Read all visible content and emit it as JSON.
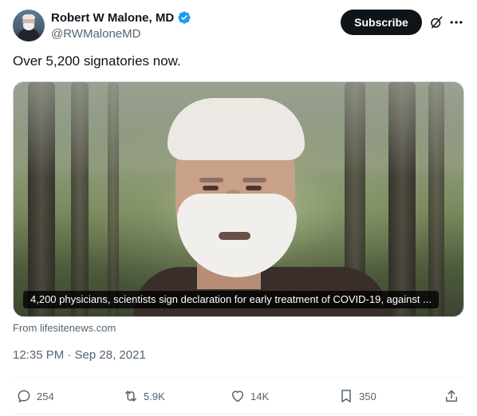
{
  "author": {
    "display_name": "Robert W Malone, MD",
    "handle": "@RWMaloneMD",
    "verified": true,
    "verified_color": "#1d9bf0"
  },
  "header": {
    "subscribe_label": "Subscribe",
    "icons": [
      "grok-icon",
      "more-icon"
    ]
  },
  "tweet": {
    "text": "Over 5,200 signatories now.",
    "media_caption": "4,200 physicians, scientists sign declaration for early treatment of COVID-19, against ...",
    "source": "From lifesitenews.com",
    "timestamp": "12:35 PM · Sep 28, 2021"
  },
  "actions": {
    "replies": "254",
    "reposts": "5.9K",
    "likes": "14K",
    "bookmarks": "350"
  },
  "colors": {
    "text": "#0f1419",
    "muted": "#536471",
    "subscribe_bg": "#0f1419"
  }
}
